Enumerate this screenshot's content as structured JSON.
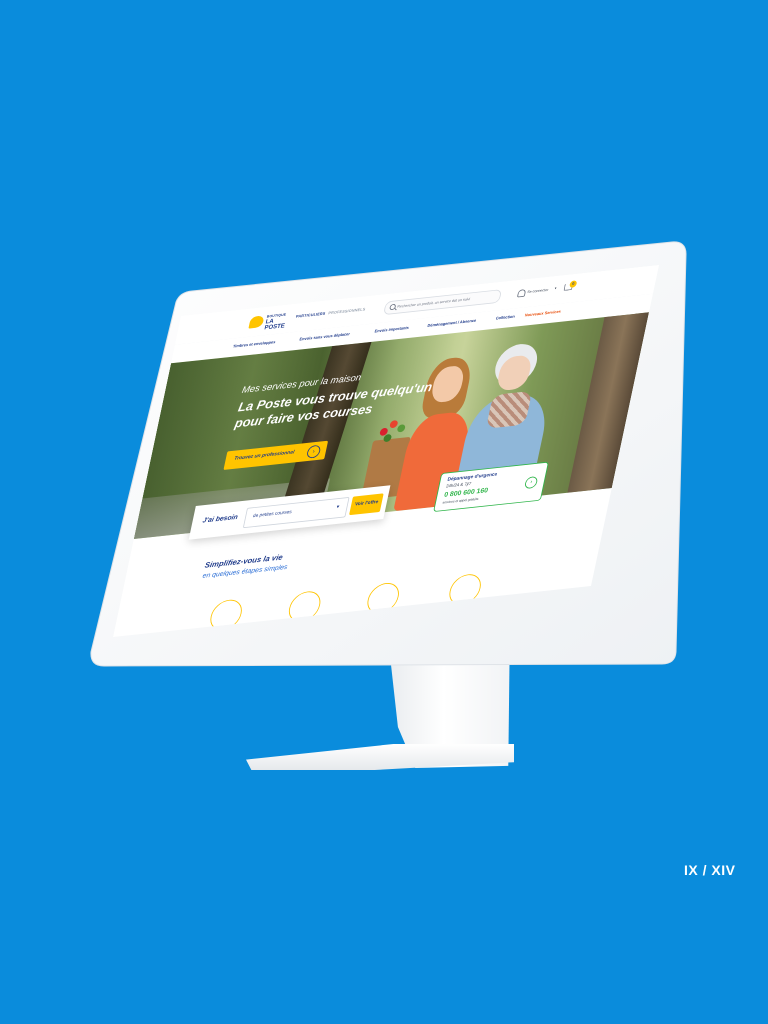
{
  "brand": {
    "logo_line1": "BOUTIQUE",
    "logo_line2": "LA POSTE"
  },
  "header": {
    "audience_tabs": [
      {
        "label": "PARTICULIERS",
        "active": true
      },
      {
        "label": "PROFESSIONNELS",
        "active": false
      }
    ],
    "search_placeholder": "Rechercher un produit, un service dat un suivi",
    "login_label": "Se connecter",
    "cart_count": "0"
  },
  "categories": [
    {
      "label": "Timbres et enveloppes"
    },
    {
      "label": "Envois sans vous déplacer"
    },
    {
      "label": "Envois importants"
    },
    {
      "label": "Déménagement / Absence"
    },
    {
      "label": "Collection"
    },
    {
      "label": "Nouveaux Services",
      "highlight": true
    }
  ],
  "hero": {
    "kicker": "Mes services pour la maison",
    "title_line1": "La Poste vous trouve quelqu'un",
    "title_line2": "pour faire vos courses",
    "cta_label": "Trouvez un professionnel",
    "slides_total": 3,
    "slide_active": 1
  },
  "need_search": {
    "label": "J'ai besoin",
    "selected_value": "de petites courses",
    "button_label": "Voir l'offre"
  },
  "urgent": {
    "title": "Dépannage d'urgence",
    "hours": "24h/24 & 7j/7",
    "phone": "0 800 600 160",
    "note": "services et appel gratuits"
  },
  "steps_section": {
    "title": "Simplifiez-vous la vie",
    "subtitle": "en quelques étapes simples"
  },
  "page_indicator": "IX / XIV",
  "colors": {
    "background": "#0a8cdc",
    "brand_blue": "#1e3a8a",
    "brand_yellow": "#ffc400",
    "accent_orange": "#e8500e",
    "urgent_green": "#2fb54a"
  }
}
